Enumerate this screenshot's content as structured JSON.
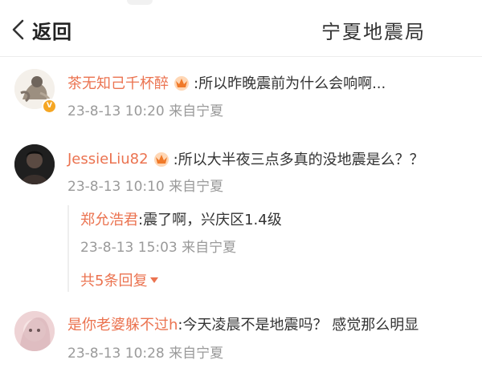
{
  "header": {
    "back_label": "返回",
    "title": "宁夏地震局"
  },
  "comments": [
    {
      "name": "茶无知己千杯醉",
      "text": ":所以昨晚震前为什么会响啊...",
      "time": "23-8-13 10:20 来自宁夏",
      "verified_badge": "V"
    },
    {
      "name": "JessieLiu82",
      "text": ":所以大半夜三点多真的没地震是么？？",
      "time": "23-8-13 10:10 来自宁夏",
      "reply": {
        "name": "郑允浩君",
        "text": ":震了啊，兴庆区1.4级",
        "time": "23-8-13 15:03 来自宁夏"
      },
      "more_replies": "共5条回复"
    },
    {
      "name": "是你老婆躲不过h",
      "text": ":今天凌晨不是地震吗？ 感觉那么明显",
      "time": "23-8-13 10:28 来自宁夏"
    }
  ],
  "colors": {
    "username": "#eb7350",
    "meta": "#9a9a9a",
    "text": "#333333",
    "badge": "#f5a623"
  },
  "icons": [
    "chevron-left-icon",
    "crown-badge-icon",
    "verified-badge-icon"
  ]
}
